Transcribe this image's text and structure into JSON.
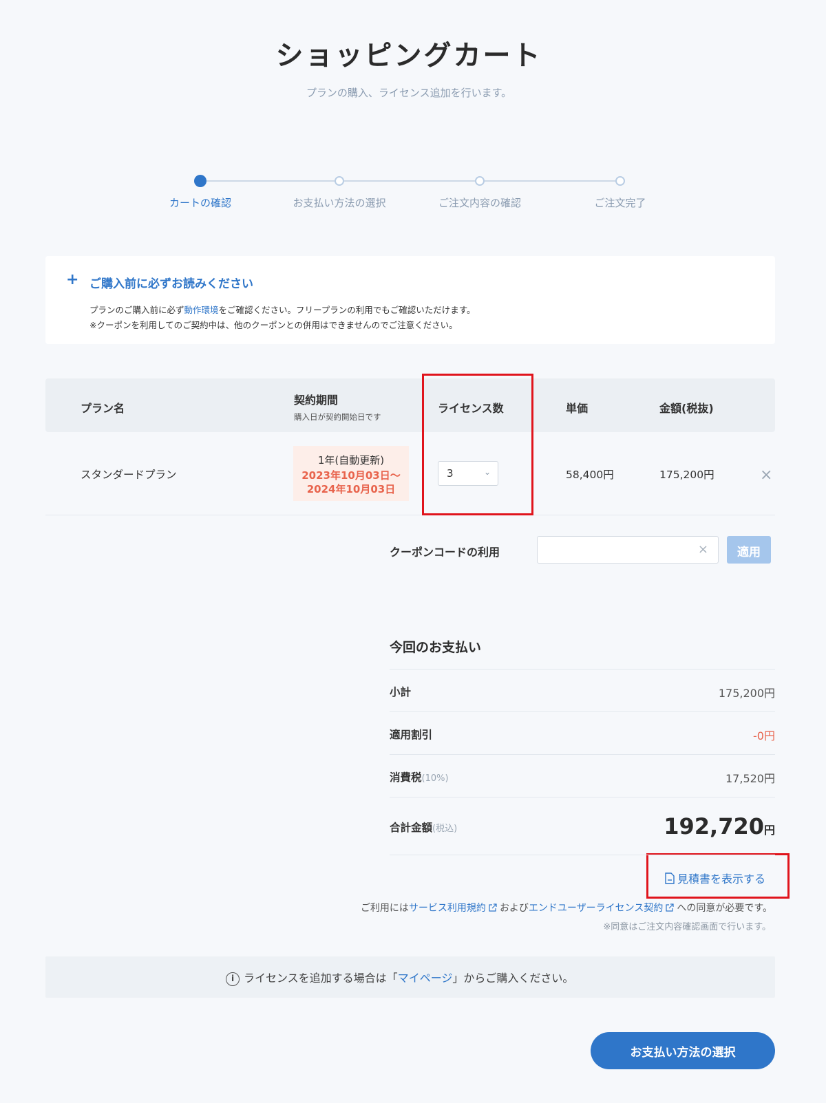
{
  "header": {
    "title": "ショッピングカート",
    "subtitle": "プランの購入、ライセンス追加を行います。"
  },
  "steps": [
    {
      "label": "カートの確認",
      "active": true
    },
    {
      "label": "お支払い方法の選択",
      "active": false
    },
    {
      "label": "ご注文内容の確認",
      "active": false
    },
    {
      "label": "ご注文完了",
      "active": false
    }
  ],
  "notice": {
    "title": "ご購入前に必ずお読みください",
    "line1_before": "プランのご購入前に必ず",
    "line1_link": "動作環境",
    "line1_after": "をご確認ください。フリープランの利用でもご確認いただけます。",
    "line2": "※クーポンを利用してのご契約中は、他のクーポンとの併用はできませんのでご注意ください。"
  },
  "table": {
    "headers": {
      "plan": "プラン名",
      "period": "契約期間",
      "period_sub": "購入日が契約開始日です",
      "licenses": "ライセンス数",
      "unit_price": "単価",
      "amount": "金額(税抜)"
    },
    "row": {
      "plan": "スタンダードプラン",
      "period_main": "1年(自動更新)",
      "period_start": "2023年10月03日～",
      "period_end": "2024年10月03日",
      "licenses": "3",
      "unit_price": "58,400円",
      "amount": "175,200円"
    }
  },
  "coupon": {
    "label": "クーポンコードの利用",
    "value": "",
    "apply": "適用"
  },
  "payment": {
    "title": "今回のお支払い",
    "subtotal_label": "小計",
    "subtotal": "175,200円",
    "discount_label": "適用割引",
    "discount": "-0円",
    "tax_label": "消費税",
    "tax_rate": "(10%)",
    "tax": "17,520円",
    "total_label": "合計金額",
    "total_note": "(税込)",
    "total": "192,720",
    "total_unit": "円"
  },
  "quote_link": "見積書を表示する",
  "terms": {
    "prefix": "ご利用には",
    "link1": "サービス利用規約",
    "middle": "および",
    "link2": "エンドユーザーライセンス契約",
    "suffix": "への同意が必要です。",
    "note": "※同意はご注文内容確認画面で行います。"
  },
  "info": {
    "before": "ライセンスを追加する場合は「",
    "link": "マイページ",
    "after": "」からご購入ください。"
  },
  "next_button": "お支払い方法の選択",
  "colors": {
    "accent": "#2f76c9",
    "alert": "#e8634c",
    "highlight": "#e0141c"
  }
}
